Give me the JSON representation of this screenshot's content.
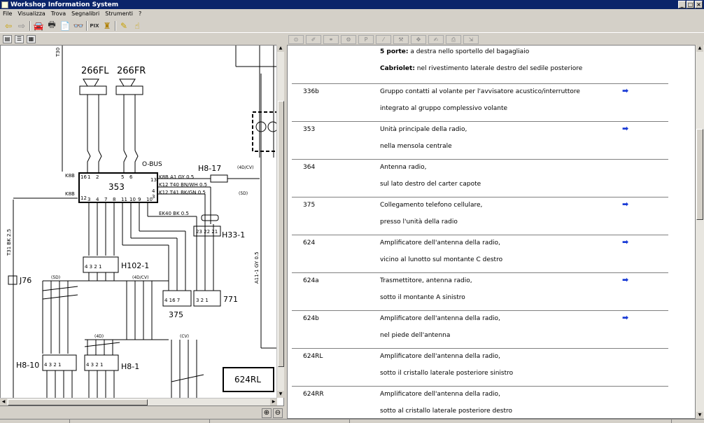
{
  "window": {
    "title": "Workshop Information System"
  },
  "menu": [
    "File",
    "Visualizza",
    "Trova",
    "Segnalibri",
    "Strumenti",
    "?"
  ],
  "toolbar": {
    "pix_label": "PIX"
  },
  "diagram": {
    "speakers": [
      "266FL",
      "266FR"
    ],
    "bus_label": "O-BUS",
    "unit": "353",
    "connectors": [
      "H8-17",
      "H33-1",
      "H102-1",
      "J76",
      "H8-10",
      "H8-1",
      "771",
      "375",
      "624RL"
    ],
    "variant_labels": [
      "(4D/CV)",
      "(5D)",
      "(5D)",
      "(4D/CV)",
      "(4D)",
      "(CV)"
    ],
    "wire_labels": {
      "a1": "K8B A1 GY 0.5",
      "t40": "K12 T40 BN/WH 0.5",
      "t41": "K12 T41 BK/GN 0.5",
      "ek40": "EK40 BK 0.5",
      "t31": "T31 BK 2.5",
      "a11": "A11-1 GY 0.5",
      "k8b_left": "K8B",
      "k8b_left2": "K8B"
    }
  },
  "document": {
    "intro": [
      {
        "bold": "5 porte:",
        "text": " a destra nello sportello del bagagliaio"
      },
      {
        "bold": "Cabriolet:",
        "text": " nel rivestimento laterale destro del sedile posteriore"
      }
    ],
    "rows": [
      {
        "code": "336b",
        "l1": "Gruppo contatti al volante per l'avvisatore acustico/interruttore",
        "l2": "integrato al gruppo complessivo volante",
        "link": "➡"
      },
      {
        "code": "353",
        "l1": "Unità principale della radio,",
        "l2": "nella mensola centrale",
        "link": "➡"
      },
      {
        "code": "364",
        "l1": "Antenna radio,",
        "l2": "sul lato destro del carter capote",
        "link": ""
      },
      {
        "code": "375",
        "l1": "Collegamento telefono cellulare,",
        "l2": "presso l'unità della radio",
        "link": "➡"
      },
      {
        "code": "624",
        "l1": "Amplificatore dell'antenna della radio,",
        "l2": "vicino al lunotto sul montante C destro",
        "link": "➡"
      },
      {
        "code": "624a",
        "l1": "Trasmettitore, antenna radio,",
        "l2": "sotto il montante A sinistro",
        "link": "➡"
      },
      {
        "code": "624b",
        "l1": "Amplificatore dell'antenna della radio,",
        "l2": "nel piede dell'antenna",
        "link": "➡"
      },
      {
        "code": "624RL",
        "l1": "Amplificatore dell'antenna della radio,",
        "l2": "sotto il cristallo laterale posteriore sinistro",
        "link": ""
      },
      {
        "code": "624RR",
        "l1": "Amplificatore dell'antenna della radio,",
        "l2": "sotto al cristallo laterale posteriore destro",
        "link": ""
      }
    ]
  }
}
